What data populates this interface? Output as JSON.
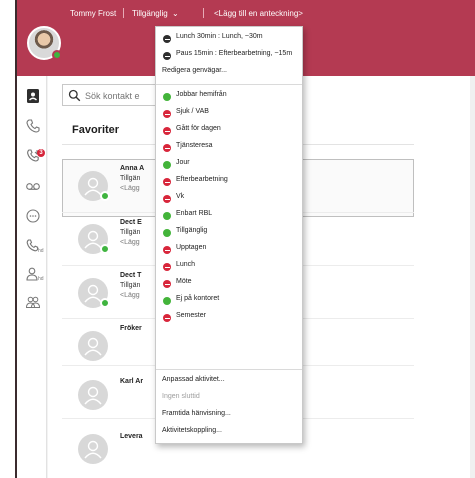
{
  "header": {
    "user_name": "Tommy Frost",
    "status": "Tillgänglig",
    "status_chevron": "⌄",
    "note": "<Lägg till en anteckning>"
  },
  "rail": {
    "icons": [
      "contacts-book-icon",
      "phone-icon",
      "call-history-icon",
      "voicemail-icon",
      "chat-icon",
      "call-queue-icon",
      "user-queue-icon",
      "groups-icon"
    ],
    "badge": "3",
    "queue_label_1": "hd",
    "queue_label_2": "hd"
  },
  "search": {
    "placeholder": "Sök kontakt e"
  },
  "favorites": {
    "title": "Favoriter",
    "contacts": [
      {
        "name": "Anna A",
        "status_line": "Tillgän",
        "note": "<Lägg"
      },
      {
        "name": "Dect E",
        "status_line": "Tillgän",
        "note": "<Lägg"
      },
      {
        "name": "Dect T",
        "status_line": "Tillgän",
        "note": "<Lägg"
      },
      {
        "name": "Fröker",
        "status_line": "",
        "note": ""
      },
      {
        "name": "Karl Ar",
        "status_line": "",
        "note": ""
      },
      {
        "name": "Levera",
        "status_line": "",
        "note": ""
      }
    ]
  },
  "menu": {
    "shortcuts": [
      {
        "label": "Lunch 30min : Lunch, ~30m",
        "kind": "short"
      },
      {
        "label": "Paus 15min : Efterbearbetning, ~15m",
        "kind": "short"
      }
    ],
    "edit_shortcuts": "Redigera genvägar...",
    "statuses": [
      {
        "label": "Jobbar hemifrån",
        "kind": "available"
      },
      {
        "label": "Sjuk / VAB",
        "kind": "busy"
      },
      {
        "label": "Gått för dagen",
        "kind": "busy"
      },
      {
        "label": "Tjänsteresa",
        "kind": "busy"
      },
      {
        "label": "Jour",
        "kind": "available"
      },
      {
        "label": "Efterbearbetning",
        "kind": "busy"
      },
      {
        "label": "Vk",
        "kind": "busy"
      },
      {
        "label": "Enbart RBL",
        "kind": "available"
      },
      {
        "label": "Tillgänglig",
        "kind": "available"
      },
      {
        "label": "Upptagen",
        "kind": "busy"
      },
      {
        "label": "Lunch",
        "kind": "busy"
      },
      {
        "label": "Möte",
        "kind": "busy"
      },
      {
        "label": "Ej på kontoret",
        "kind": "available"
      },
      {
        "label": "Semester",
        "kind": "busy"
      }
    ],
    "footer": [
      {
        "label": "Anpassad aktivitet...",
        "disabled": false
      },
      {
        "label": "Ingen sluttid",
        "disabled": true
      },
      {
        "label": "Framtida hänvisning...",
        "disabled": false
      },
      {
        "label": "Aktivitetskoppling...",
        "disabled": false
      }
    ]
  },
  "colors": {
    "header": "#b43a52",
    "available": "#43b43a",
    "busy": "#d8263b",
    "shortcut": "#2e2e2e"
  }
}
